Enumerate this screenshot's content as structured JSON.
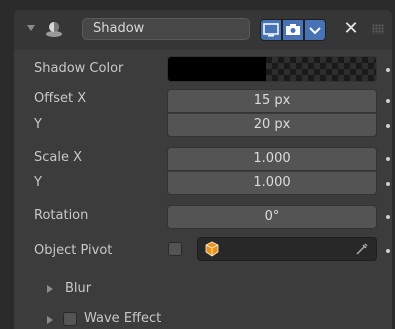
{
  "modifier": {
    "name": "Shadow",
    "close_symbol": "✕"
  },
  "properties": {
    "shadow_color_label": "Shadow Color",
    "offset_x_label": "Offset X",
    "offset_x_value": "15 px",
    "offset_y_label": "Y",
    "offset_y_value": "20 px",
    "scale_x_label": "Scale X",
    "scale_x_value": "1.000",
    "scale_y_label": "Y",
    "scale_y_value": "1.000",
    "rotation_label": "Rotation",
    "rotation_value": "0°",
    "object_pivot_label": "Object Pivot"
  },
  "subpanels": {
    "blur_label": "Blur",
    "wave_effect_label": "Wave Effect"
  },
  "colors": {
    "accent": "#4772b3",
    "shadow_color": "#000000",
    "object_orange": "#e8931e"
  }
}
